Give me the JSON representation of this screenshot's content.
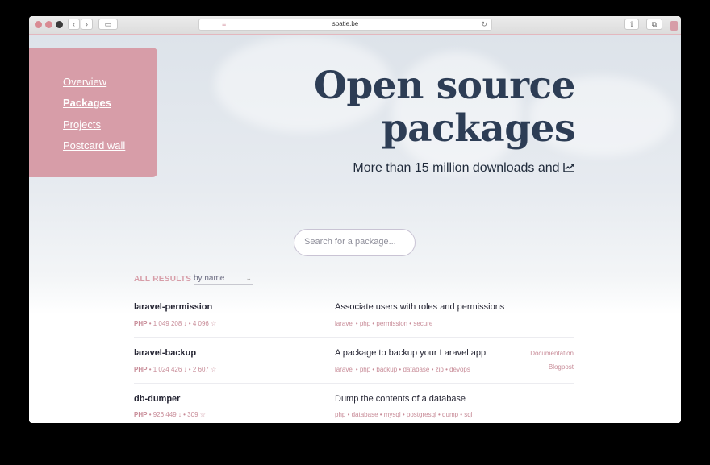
{
  "browser": {
    "address": "spatie.be",
    "reader_icon": "ⓘ",
    "lines_icon": "≡",
    "reload_icon": "↻",
    "back_icon": "‹",
    "forward_icon": "›",
    "sidebar_icon": "▭",
    "share_icon": "⇧",
    "tabs_icon": "⧉"
  },
  "nav": {
    "items": [
      {
        "label": "Overview"
      },
      {
        "label": "Packages"
      },
      {
        "label": "Projects"
      },
      {
        "label": "Postcard wall"
      }
    ]
  },
  "hero": {
    "title_line1": "Open source",
    "title_line2": "packages",
    "subtitle": "More than 15 million downloads and ",
    "trend_icon": "📈"
  },
  "search": {
    "placeholder": "Search for a package..."
  },
  "results": {
    "label": "ALL RESULTS",
    "sort": "by name",
    "chevron": "⌄"
  },
  "packages": [
    {
      "name": "laravel-permission",
      "lang": "PHP",
      "downloads": "1 049 208",
      "stars": "4 096",
      "description": "Associate users with roles and permissions",
      "tags": "laravel • php • permission • secure",
      "links": []
    },
    {
      "name": "laravel-backup",
      "lang": "PHP",
      "downloads": "1 024 426",
      "stars": "2 607",
      "description": "A package to backup your Laravel app",
      "tags": "laravel • php • backup • database • zip • devops",
      "links": [
        "Documentation",
        "Blogpost"
      ]
    },
    {
      "name": "db-dumper",
      "lang": "PHP",
      "downloads": "926 449",
      "stars": "309",
      "description": "Dump the contents of a database",
      "tags": "php • database • mysql • postgresql • dump • sql",
      "links": []
    }
  ],
  "meta_symbols": {
    "dot": "•",
    "download": "↓",
    "star": "☆"
  },
  "colors": {
    "accent": "#d79da8",
    "title": "#2d3d55",
    "text": "#252533"
  }
}
